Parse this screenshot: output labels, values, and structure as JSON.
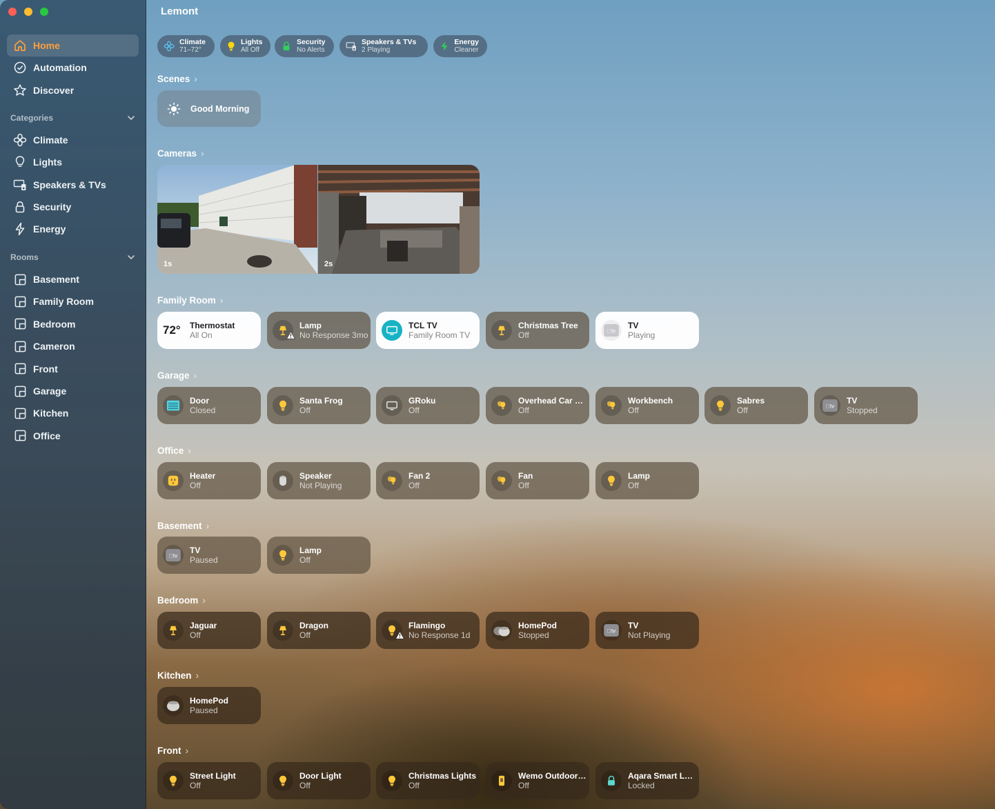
{
  "window": {
    "title": "Lemont"
  },
  "sidebar": {
    "main": [
      {
        "label": "Home",
        "icon": "house-icon",
        "active": true
      },
      {
        "label": "Automation",
        "icon": "clock-check-icon"
      },
      {
        "label": "Discover",
        "icon": "star-icon"
      }
    ],
    "categories_label": "Categories",
    "categories": [
      {
        "label": "Climate",
        "icon": "fan-icon"
      },
      {
        "label": "Lights",
        "icon": "lightbulb-icon"
      },
      {
        "label": "Speakers & TVs",
        "icon": "tv-speaker-icon"
      },
      {
        "label": "Security",
        "icon": "lock-icon"
      },
      {
        "label": "Energy",
        "icon": "bolt-icon"
      }
    ],
    "rooms_label": "Rooms",
    "rooms": [
      "Basement",
      "Family Room",
      "Bedroom",
      "Cameron",
      "Front",
      "Garage",
      "Kitchen",
      "Office"
    ]
  },
  "summary": [
    {
      "title": "Climate",
      "sub": "71–72°",
      "icon": "fan-icon",
      "color": "#5ac8fa"
    },
    {
      "title": "Lights",
      "sub": "All Off",
      "icon": "lightbulb-icon",
      "color": "#ffd60a"
    },
    {
      "title": "Security",
      "sub": "No Alerts",
      "icon": "lock-icon",
      "color": "#30d158"
    },
    {
      "title": "Speakers & TVs",
      "sub": "2 Playing",
      "icon": "tv-speaker-icon",
      "color": "#e5e5ea"
    },
    {
      "title": "Energy",
      "sub": "Cleaner",
      "icon": "bolt-icon",
      "color": "#30d158"
    }
  ],
  "scenes": {
    "title": "Scenes",
    "items": [
      {
        "label": "Good Morning",
        "icon": "sun-icon"
      }
    ]
  },
  "cameras": {
    "title": "Cameras",
    "items": [
      {
        "label": "1s"
      },
      {
        "label": "2s"
      }
    ]
  },
  "rooms": [
    {
      "title": "Family Room",
      "tiles": [
        {
          "name": "Thermostat",
          "status": "All On",
          "icon": "temp-readout",
          "temp": "72°",
          "style": "light"
        },
        {
          "name": "Lamp",
          "status": "No Response 3mo",
          "icon": "lamp-icon",
          "warn": true,
          "style": "mid"
        },
        {
          "name": "TCL TV",
          "status": "Family Room TV",
          "icon": "tv-icon",
          "style": "light",
          "accent": true
        },
        {
          "name": "Christmas Tree",
          "status": "Off",
          "icon": "lamp-icon",
          "style": "mid"
        },
        {
          "name": "TV",
          "status": "Playing",
          "icon": "appletv-icon",
          "style": "light"
        }
      ]
    },
    {
      "title": "Garage",
      "tiles": [
        {
          "name": "Door",
          "status": "Closed",
          "icon": "garage-door-icon"
        },
        {
          "name": "Santa Frog",
          "status": "Off",
          "icon": "lightbulb-icon"
        },
        {
          "name": "GRoku",
          "status": "Off",
          "icon": "tv-icon"
        },
        {
          "name": "Overhead Car L…",
          "status": "Off",
          "icon": "bulbs-icon"
        },
        {
          "name": "Workbench",
          "status": "Off",
          "icon": "bulbs-icon"
        },
        {
          "name": "Sabres",
          "status": "Off",
          "icon": "lightbulb-icon"
        },
        {
          "name": "TV",
          "status": "Stopped",
          "icon": "appletv-icon"
        }
      ]
    },
    {
      "title": "Office",
      "tiles": [
        {
          "name": "Heater",
          "status": "Off",
          "icon": "outlet-icon"
        },
        {
          "name": "Speaker",
          "status": "Not Playing",
          "icon": "homepod-icon"
        },
        {
          "name": "Fan 2",
          "status": "Off",
          "icon": "bulbs-icon"
        },
        {
          "name": "Fan",
          "status": "Off",
          "icon": "bulbs-icon"
        },
        {
          "name": "Lamp",
          "status": "Off",
          "icon": "lightbulb-icon"
        }
      ]
    },
    {
      "title": "Basement",
      "tiles": [
        {
          "name": "TV",
          "status": "Paused",
          "icon": "appletv-icon"
        },
        {
          "name": "Lamp",
          "status": "Off",
          "icon": "lightbulb-icon"
        }
      ]
    },
    {
      "title": "Bedroom",
      "tiles": [
        {
          "name": "Jaguar",
          "status": "Off",
          "icon": "lamp-icon"
        },
        {
          "name": "Dragon",
          "status": "Off",
          "icon": "lamp-icon"
        },
        {
          "name": "Flamingo",
          "status": "No Response 1d",
          "icon": "lightbulb-icon",
          "warn": true
        },
        {
          "name": "HomePod",
          "status": "Stopped",
          "icon": "homepod-mini-pair-icon"
        },
        {
          "name": "TV",
          "status": "Not Playing",
          "icon": "appletv-icon"
        }
      ]
    },
    {
      "title": "Kitchen",
      "tiles": [
        {
          "name": "HomePod",
          "status": "Paused",
          "icon": "homepod-mini-icon"
        }
      ]
    },
    {
      "title": "Front",
      "tiles": [
        {
          "name": "Street Light",
          "status": "Off",
          "icon": "lightbulb-icon"
        },
        {
          "name": "Door Light",
          "status": "Off",
          "icon": "lightbulb-icon"
        },
        {
          "name": "Christmas Lights",
          "status": "Off",
          "icon": "lightbulb-icon"
        },
        {
          "name": "Wemo Outdoor…",
          "status": "Off",
          "icon": "plug-icon"
        },
        {
          "name": "Aqara Smart Lock",
          "status": "Locked",
          "icon": "lock-icon"
        }
      ]
    }
  ]
}
